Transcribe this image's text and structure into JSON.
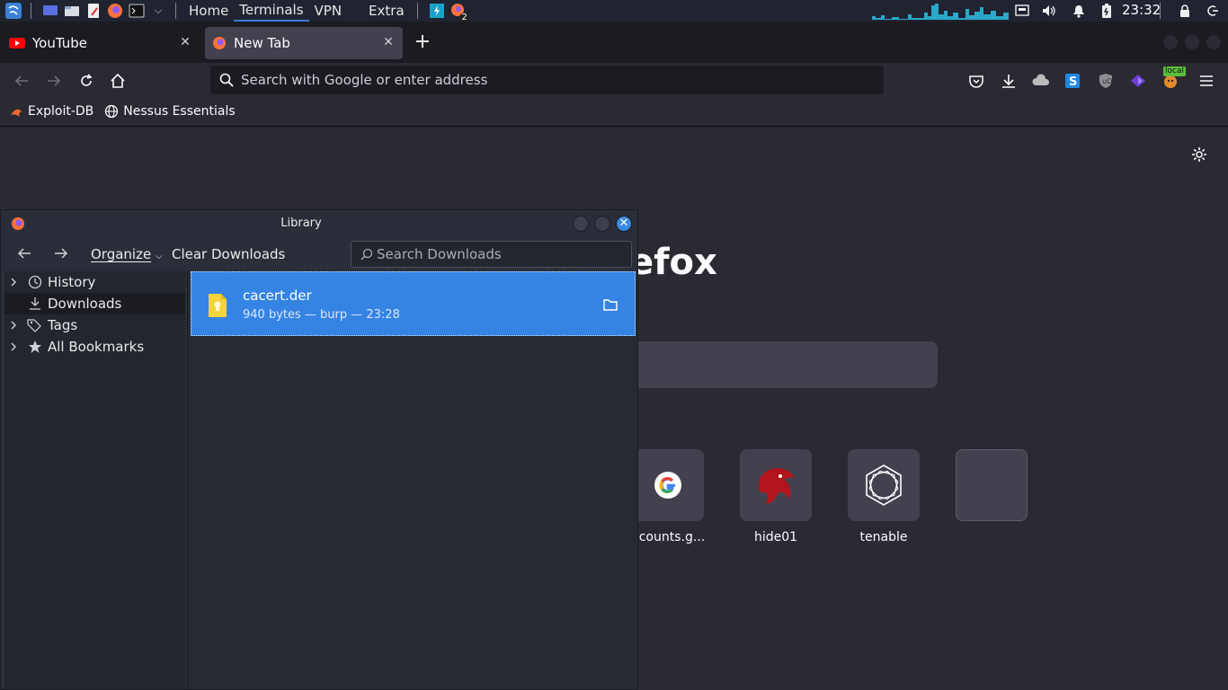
{
  "panel": {
    "menus": [
      "Home",
      "Terminals",
      "VPN",
      "Extra"
    ],
    "active_menu": "Terminals",
    "badge": "2",
    "clock": "23:32"
  },
  "browser": {
    "tabs": [
      {
        "label": "YouTube"
      },
      {
        "label": "New Tab"
      }
    ],
    "url_placeholder": "Search with Google or enter address",
    "extension_badge": "local",
    "bookmarks": [
      "Exploit-DB",
      "Nessus Essentials"
    ]
  },
  "newtab": {
    "brand_partial": "efox",
    "top_sites": [
      {
        "label": "ccounts.g..."
      },
      {
        "label": "hide01"
      },
      {
        "label": "tenable"
      },
      {
        "label": ""
      }
    ]
  },
  "library": {
    "title": "Library",
    "organize_label": "Organize",
    "clear_label": "Clear Downloads",
    "search_placeholder": "Search Downloads",
    "sidebar": [
      {
        "label": "History",
        "icon": "clock-icon",
        "expandable": true
      },
      {
        "label": "Downloads",
        "icon": "download-icon",
        "expandable": false,
        "selected": true
      },
      {
        "label": "Tags",
        "icon": "tag-icon",
        "expandable": true
      },
      {
        "label": "All Bookmarks",
        "icon": "star-icon",
        "expandable": true
      }
    ],
    "downloads": [
      {
        "name": "cacert.der",
        "meta": "940 bytes — burp — 23:28"
      }
    ]
  },
  "colors": {
    "selection": "#3584e4",
    "close_button": "#3a8ae0"
  }
}
